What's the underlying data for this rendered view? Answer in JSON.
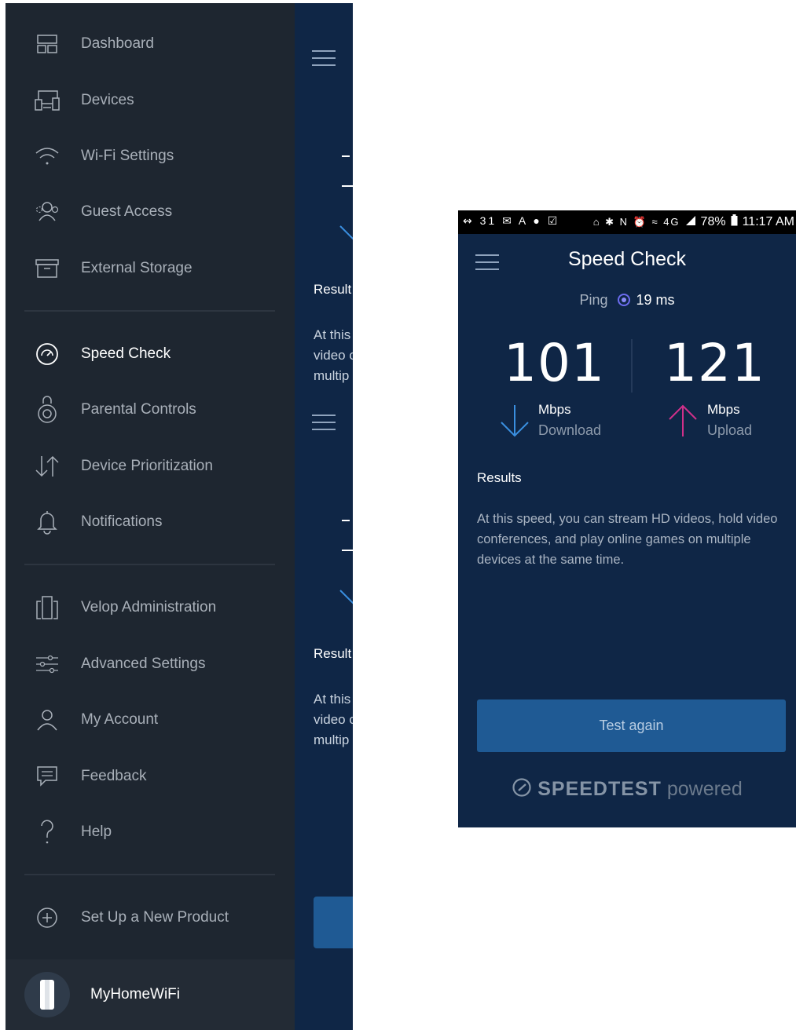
{
  "drawer": {
    "items": [
      {
        "label": "Dashboard",
        "icon": "dashboard-icon"
      },
      {
        "label": "Devices",
        "icon": "devices-icon"
      },
      {
        "label": "Wi-Fi Settings",
        "icon": "wifi-icon"
      },
      {
        "label": "Guest Access",
        "icon": "guest-icon"
      },
      {
        "label": "External Storage",
        "icon": "storage-icon"
      },
      {
        "label": "Speed Check",
        "icon": "speed-check-icon",
        "active": true
      },
      {
        "label": "Parental Controls",
        "icon": "parental-controls-icon"
      },
      {
        "label": "Device Prioritization",
        "icon": "prioritization-icon"
      },
      {
        "label": "Notifications",
        "icon": "bell-icon"
      },
      {
        "label": "Velop Administration",
        "icon": "velop-admin-icon"
      },
      {
        "label": "Advanced Settings",
        "icon": "sliders-icon"
      },
      {
        "label": "My Account",
        "icon": "user-icon"
      },
      {
        "label": "Feedback",
        "icon": "feedback-icon"
      },
      {
        "label": "Help",
        "icon": "help-icon"
      },
      {
        "label": "Set Up a New Product",
        "icon": "plus-circle-icon"
      }
    ],
    "network_name": "MyHomeWiFi"
  },
  "background_page": {
    "results_label": "Result",
    "text_lines": [
      "At this",
      "video c",
      "multip"
    ]
  },
  "status_bar": {
    "left_icons": "↭ 31 ✉ A ● ☑",
    "right_icons": "⌂ ✱ N ⏰ ≈ 4G",
    "battery": "78%",
    "time": "11:17 AM"
  },
  "speed_check": {
    "title": "Speed Check",
    "ping_label": "Ping",
    "ping_value": "19 ms",
    "download": {
      "value": "101",
      "unit": "Mbps",
      "caption": "Download"
    },
    "upload": {
      "value": "121",
      "unit": "Mbps",
      "caption": "Upload"
    },
    "results_title": "Results",
    "results_text": "At this speed, you can stream HD videos, hold video conferences, and play online games on multiple devices at the same time.",
    "test_again_label": "Test again",
    "brand_bold": "SPEEDTEST",
    "brand_light": "powered"
  },
  "colors": {
    "drawer_bg": "#1e2630",
    "page_bg": "#0f2646",
    "download_arrow": "#3a8fe0",
    "upload_arrow": "#d0308a",
    "button_bg": "#1f5a94"
  }
}
